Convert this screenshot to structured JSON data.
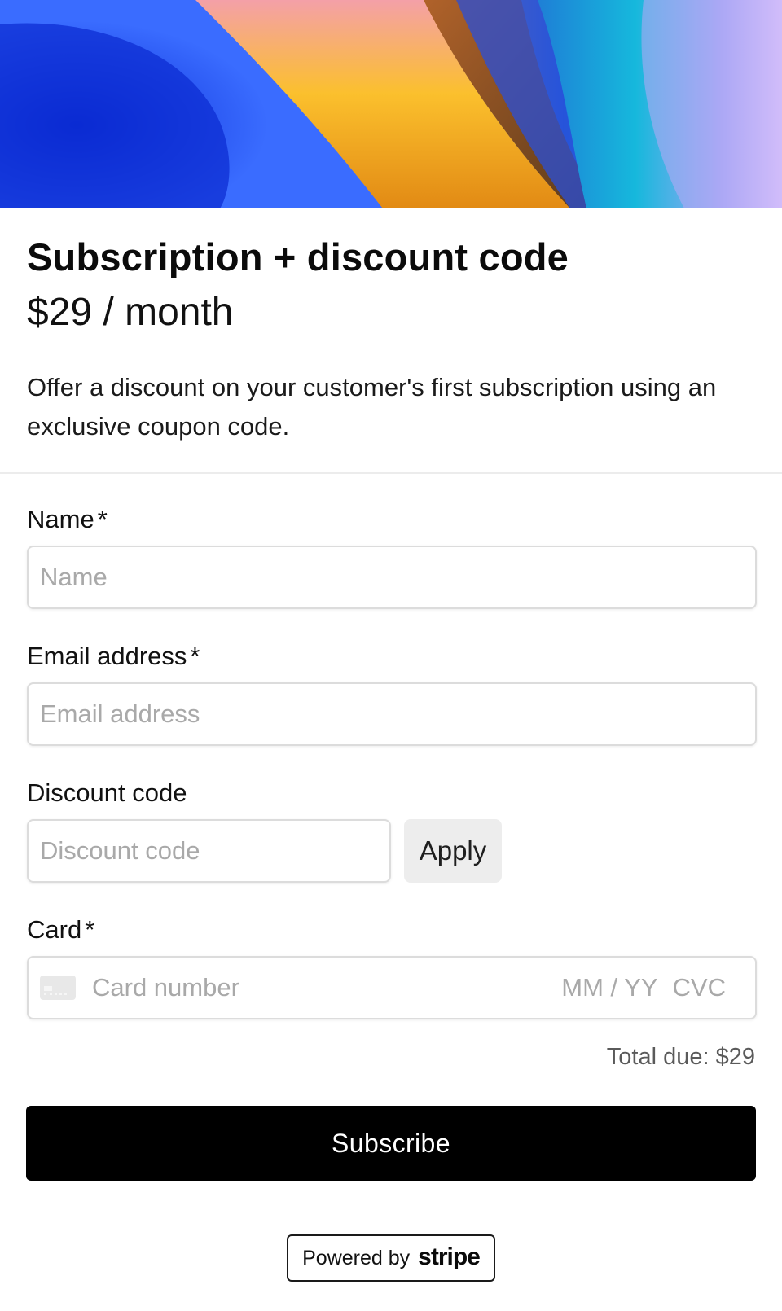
{
  "product": {
    "title": "Subscription + discount code",
    "price": "$29 / month",
    "description": "Offer a discount on your customer's first subscription using an exclusive coupon code."
  },
  "form": {
    "name": {
      "label": "Name",
      "required_mark": "*",
      "placeholder": "Name",
      "value": ""
    },
    "email": {
      "label": "Email address",
      "required_mark": "*",
      "placeholder": "Email address",
      "value": ""
    },
    "discount": {
      "label": "Discount code",
      "placeholder": "Discount code",
      "value": "",
      "apply_label": "Apply"
    },
    "card": {
      "label": "Card",
      "required_mark": "*",
      "icon": "credit-card-icon",
      "number_placeholder": "Card number",
      "expiry_placeholder": "MM / YY",
      "cvc_placeholder": "CVC"
    }
  },
  "summary": {
    "total_due": "Total due: $29"
  },
  "actions": {
    "subscribe_label": "Subscribe"
  },
  "footer": {
    "powered_by": "Powered by",
    "brand": "stripe"
  },
  "colors": {
    "primary_button": "#000000",
    "apply_button": "#ededed",
    "placeholder": "#a9a9a9",
    "border": "#dcdcdc"
  }
}
